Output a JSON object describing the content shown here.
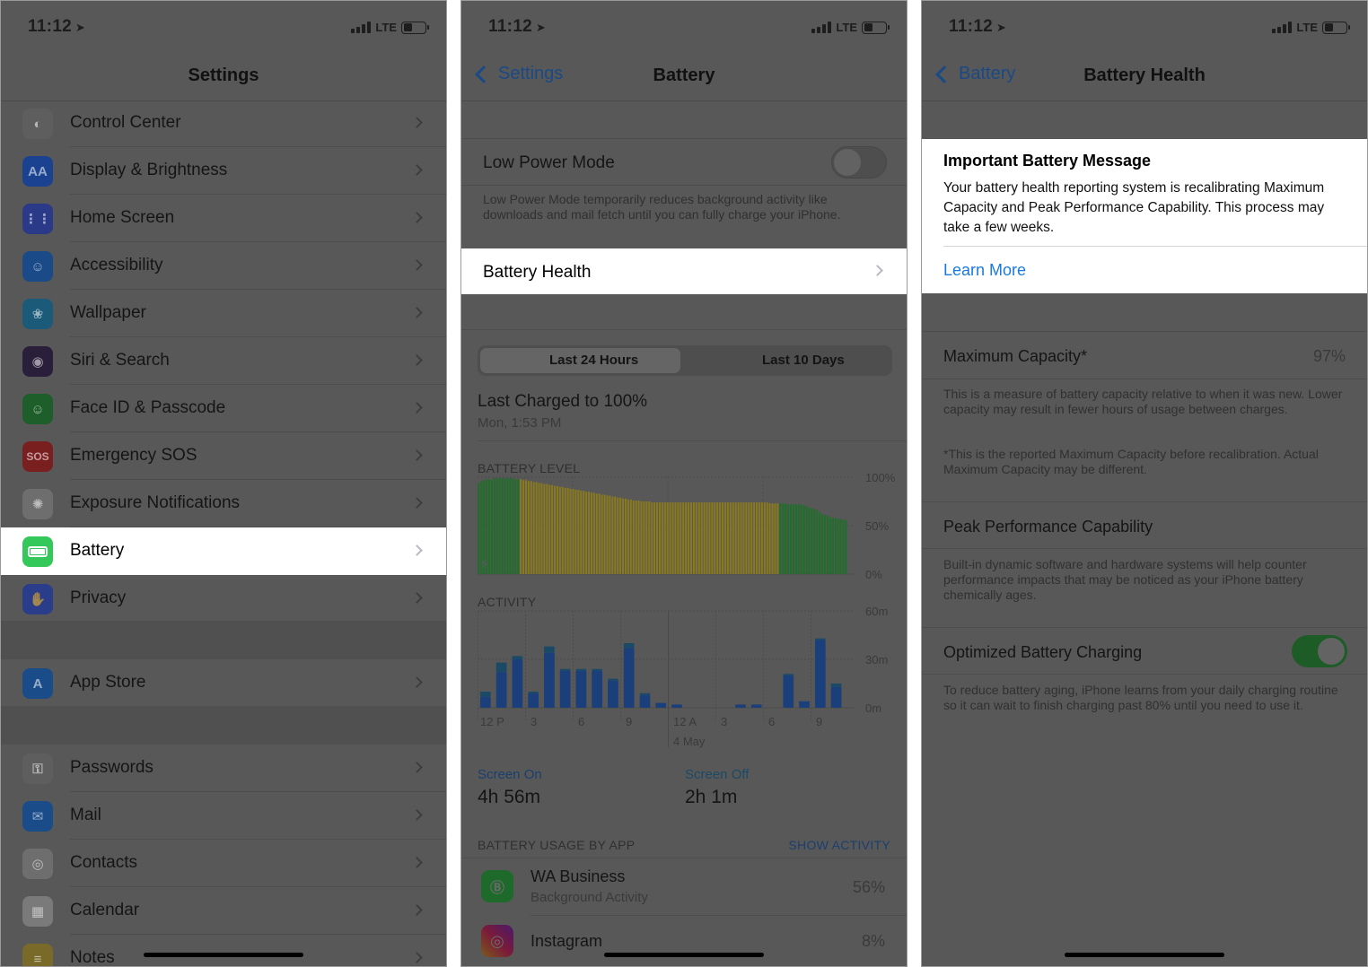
{
  "status": {
    "time": "11:12",
    "network": "LTE"
  },
  "phone1": {
    "title": "Settings",
    "group1": [
      {
        "label": "Control Center",
        "icon": "control-center-icon",
        "color": "#5e5e5e",
        "glyph": "◐"
      },
      {
        "label": "Display & Brightness",
        "icon": "display-brightness-icon",
        "color": "#1a4290",
        "glyph": "AA"
      },
      {
        "label": "Home Screen",
        "icon": "home-screen-icon",
        "color": "#2a3a88",
        "glyph": "⋮⋮"
      },
      {
        "label": "Accessibility",
        "icon": "accessibility-icon",
        "color": "#1a4a88",
        "glyph": "☺"
      },
      {
        "label": "Wallpaper",
        "icon": "wallpaper-icon",
        "color": "#1c5a7a",
        "glyph": "❀"
      },
      {
        "label": "Siri & Search",
        "icon": "siri-icon",
        "color": "#2a1f3a",
        "glyph": "◉"
      },
      {
        "label": "Face ID & Passcode",
        "icon": "face-id-icon",
        "color": "#1e5e2a",
        "glyph": "☺"
      },
      {
        "label": "Emergency SOS",
        "icon": "sos-icon",
        "color": "#7a1f1f",
        "glyph": "SOS"
      },
      {
        "label": "Exposure Notifications",
        "icon": "exposure-icon",
        "color": "#6e6e6e",
        "glyph": "✺"
      },
      {
        "label": "Battery",
        "icon": "battery-icon",
        "color": "#34c759",
        "glyph": "▬"
      },
      {
        "label": "Privacy",
        "icon": "privacy-hand-icon",
        "color": "#2a3d8a",
        "glyph": "✋"
      }
    ],
    "group2": [
      {
        "label": "App Store",
        "icon": "app-store-icon",
        "color": "#1a4c8a",
        "glyph": "A"
      }
    ],
    "group3": [
      {
        "label": "Passwords",
        "icon": "key-icon",
        "color": "#5e5e5e",
        "glyph": "⚿"
      },
      {
        "label": "Mail",
        "icon": "mail-icon",
        "color": "#1a4c8a",
        "glyph": "✉"
      },
      {
        "label": "Contacts",
        "icon": "contacts-icon",
        "color": "#6e6e6e",
        "glyph": "◎"
      },
      {
        "label": "Calendar",
        "icon": "calendar-icon",
        "color": "#7a7a7a",
        "glyph": "▦"
      },
      {
        "label": "Notes",
        "icon": "notes-icon",
        "color": "#7a6a2a",
        "glyph": "≡"
      }
    ]
  },
  "phone2": {
    "back": "Settings",
    "title": "Battery",
    "low_power_label": "Low Power Mode",
    "low_power_footer": "Low Power Mode temporarily reduces background activity like downloads and mail fetch until you can fully charge your iPhone.",
    "battery_health_label": "Battery Health",
    "tab_24h": "Last 24 Hours",
    "tab_10d": "Last 10 Days",
    "last_charged": "Last Charged to 100%",
    "last_charged_time": "Mon, 1:53 PM",
    "battery_level_label": "BATTERY LEVEL",
    "activity_label": "ACTIVITY",
    "level_ticks": [
      "100%",
      "50%",
      "0%"
    ],
    "activity_ticks": [
      "60m",
      "30m",
      "0m"
    ],
    "x_ticks": [
      "12 P",
      "3",
      "6",
      "9",
      "12 A",
      "3",
      "6",
      "9"
    ],
    "x_date": "4 May",
    "screen_on_label": "Screen On",
    "screen_on_value": "4h 56m",
    "screen_off_label": "Screen Off",
    "screen_off_value": "2h 1m",
    "usage_label": "BATTERY USAGE BY APP",
    "show_activity": "SHOW ACTIVITY",
    "apps": [
      {
        "name": "WA Business",
        "sub": "Background Activity",
        "pct": "56%"
      },
      {
        "name": "Instagram",
        "sub": "",
        "pct": "8%"
      }
    ]
  },
  "phone3": {
    "back": "Battery",
    "title": "Battery Health",
    "msg_title": "Important Battery Message",
    "msg_body": "Your battery health reporting system is recalibrating Maximum Capacity and Peak Performance Capability. This process may take a few weeks.",
    "learn_more": "Learn More",
    "max_cap_label": "Maximum Capacity*",
    "max_cap_value": "97%",
    "max_cap_footer1": "This is a measure of battery capacity relative to when it was new. Lower capacity may result in fewer hours of usage between charges.",
    "max_cap_footer2": "*This is the reported Maximum Capacity before recalibration. Actual Maximum Capacity may be different.",
    "peak_label": "Peak Performance Capability",
    "peak_footer": "Built-in dynamic software and hardware systems will help counter performance impacts that may be noticed as your iPhone battery chemically ages.",
    "opt_label": "Optimized Battery Charging",
    "opt_footer": "To reduce battery aging, iPhone learns from your daily charging routine so it can wait to finish charging past 80% until you need to use it."
  },
  "chart_data": [
    {
      "type": "bar",
      "title": "BATTERY LEVEL",
      "ylim": [
        0,
        100
      ],
      "y_ticks": [
        "100%",
        "50%",
        "0%"
      ],
      "series": [
        {
          "name": "",
          "values": [
            94,
            96,
            97,
            98,
            98,
            97,
            99,
            99,
            99,
            99,
            99,
            99,
            99,
            99,
            98,
            98,
            98,
            97,
            97,
            96,
            96,
            95,
            95,
            94,
            94,
            93,
            93,
            92,
            92,
            91,
            91,
            90,
            90,
            89,
            89,
            88,
            88,
            87,
            87,
            86,
            86,
            85,
            85,
            84,
            84,
            83,
            83,
            82,
            82,
            81,
            81,
            80,
            80,
            79,
            79,
            78,
            78,
            77,
            77,
            76,
            76,
            76,
            75,
            75,
            75,
            75,
            74,
            74,
            74,
            74,
            74,
            74,
            74,
            74,
            74,
            74,
            74,
            74,
            74,
            74,
            74,
            74,
            74,
            74,
            74,
            74,
            74,
            74,
            74,
            74,
            74,
            74,
            74,
            74,
            74,
            74,
            74,
            74,
            74,
            74,
            74,
            74,
            74,
            74,
            74,
            74,
            74,
            74,
            74,
            74,
            74,
            73,
            73,
            73,
            73,
            73,
            73,
            73,
            72,
            72,
            72,
            72,
            72,
            72,
            71,
            70,
            69,
            68,
            67,
            66,
            64,
            62,
            61,
            60,
            59,
            58,
            58,
            57,
            57,
            56,
            56
          ]
        }
      ],
      "colors": {
        "charging": "#1f6e2a",
        "low_power": "#8a7a1e"
      }
    },
    {
      "type": "bar",
      "title": "ACTIVITY",
      "ylim": [
        0,
        60
      ],
      "y_ticks": [
        "60m",
        "30m",
        "0m"
      ],
      "categories": [
        "12 P",
        "3",
        "6",
        "9",
        "12 A",
        "3",
        "6",
        "9"
      ],
      "series": [
        {
          "name": "Screen On",
          "values": [
            7,
            22,
            30,
            9,
            34,
            23,
            23,
            23,
            17,
            37,
            8,
            3,
            2,
            0,
            0,
            0,
            2,
            2,
            0,
            20,
            4,
            42,
            13
          ]
        },
        {
          "name": "Screen Off",
          "values": [
            3,
            6,
            2,
            1,
            4,
            1,
            1,
            1,
            1,
            3,
            1,
            0,
            0,
            0,
            0,
            0,
            0,
            0,
            0,
            1,
            0,
            1,
            2
          ]
        }
      ],
      "colors": {
        "screen_on": "#1a3f7a",
        "screen_off": "#1a4a66"
      }
    }
  ]
}
